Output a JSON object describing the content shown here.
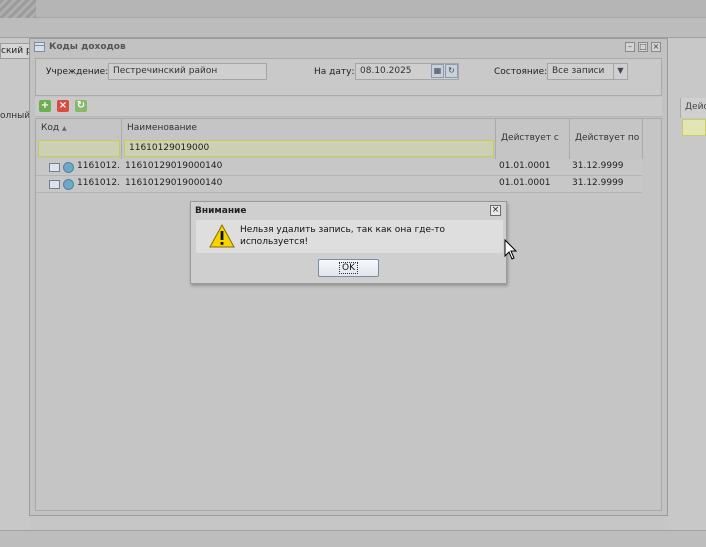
{
  "background": {
    "left_tab_fragment": "ский ра",
    "left_row_fragment": "олный",
    "right_header_fragment": "Дейс"
  },
  "window": {
    "title": "Коды доходов"
  },
  "filters": {
    "institution_label": "Учреждение:",
    "institution_value": "Пестречинский район",
    "date_label": "На дату:",
    "date_value": "08.10.2025",
    "state_label": "Состояние:",
    "state_value": "Все записи"
  },
  "toolbar": {
    "add_icon": "add-icon",
    "delete_icon": "delete-icon",
    "refresh_icon": "refresh-icon"
  },
  "grid": {
    "columns": {
      "code": "Код",
      "name": "Наименование",
      "valid_from": "Действует с",
      "valid_to": "Действует по"
    },
    "filter_name": "11610129019000",
    "rows": [
      {
        "code": "1161012...",
        "name": "11610129019000140",
        "valid_from": "01.01.0001",
        "valid_to": "31.12.9999"
      },
      {
        "code": "1161012...",
        "name": "11610129019000140",
        "valid_from": "01.01.0001",
        "valid_to": "31.12.9999"
      }
    ]
  },
  "dialog": {
    "title": "Внимание",
    "message": "Нельзя удалить запись, так как она где-то\nиспользуется!",
    "ok_label": "OK",
    "icon": "warning-icon"
  },
  "colors": {
    "filter_highlight": "#c6cc55",
    "warning_yellow": "#f5d400"
  }
}
